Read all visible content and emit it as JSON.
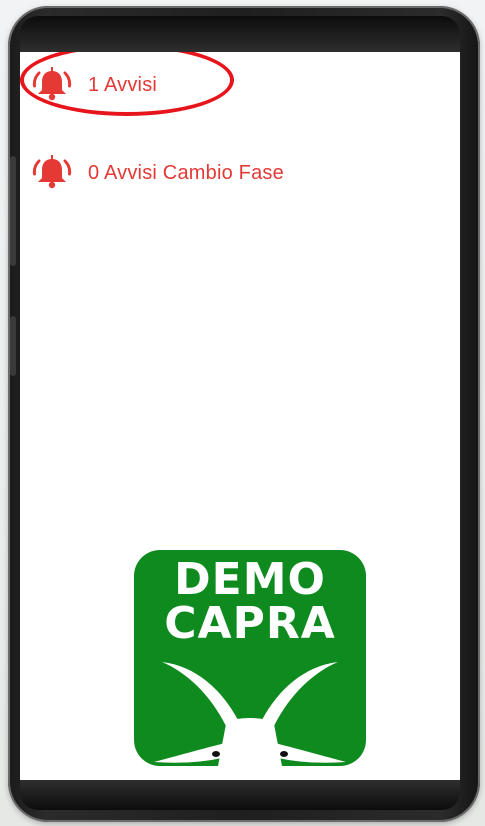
{
  "alerts": {
    "avvisi_label": "1 Avvisi",
    "cambio_fase_label": "0 Avvisi Cambio Fase"
  },
  "logo": {
    "line1": "DEMO",
    "line2": "CAPRA"
  },
  "colors": {
    "alert_red": "#e53935",
    "highlight_red": "#e8141b",
    "logo_green": "#0f8a1e"
  },
  "icons": [
    "bell-ringing-icon",
    "goat-logo"
  ]
}
